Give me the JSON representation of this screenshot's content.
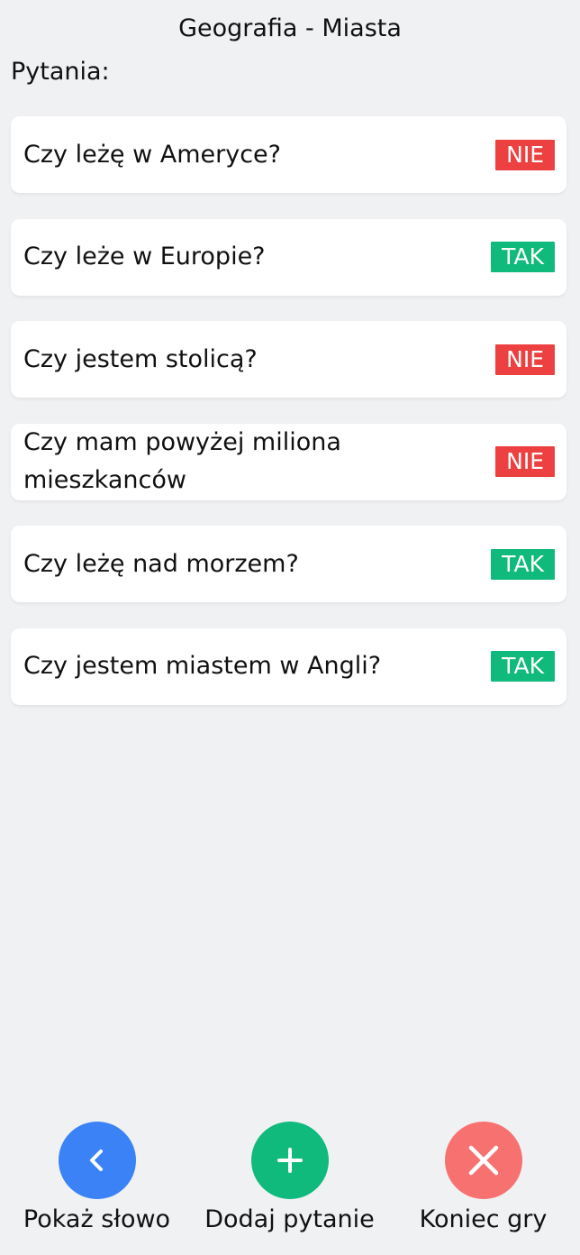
{
  "header": {
    "title": "Geografia - Miasta",
    "section_label": "Pytania:"
  },
  "questions": [
    {
      "text": "Czy leżę w Ameryce?",
      "answer": "NIE"
    },
    {
      "text": "Czy leże w Europie?",
      "answer": "TAK"
    },
    {
      "text": "Czy jestem stolicą?",
      "answer": "NIE"
    },
    {
      "text": "Czy mam powyżej miliona mieszkanców",
      "answer": "NIE"
    },
    {
      "text": "Czy leżę nad morzem?",
      "answer": "TAK"
    },
    {
      "text": "Czy jestem miastem w Angli?",
      "answer": "TAK"
    }
  ],
  "actions": {
    "show_word": {
      "label": "Pokaż słowo",
      "icon": "chevron-left-icon",
      "color": "#3b82f6"
    },
    "add_question": {
      "label": "Dodaj pytanie",
      "icon": "plus-icon",
      "color": "#10b97c"
    },
    "end_game": {
      "label": "Koniec gry",
      "icon": "close-icon",
      "color": "#f87171"
    }
  },
  "colors": {
    "background": "#f0f1f3",
    "yes": "#10b97c",
    "no": "#ec4140"
  }
}
